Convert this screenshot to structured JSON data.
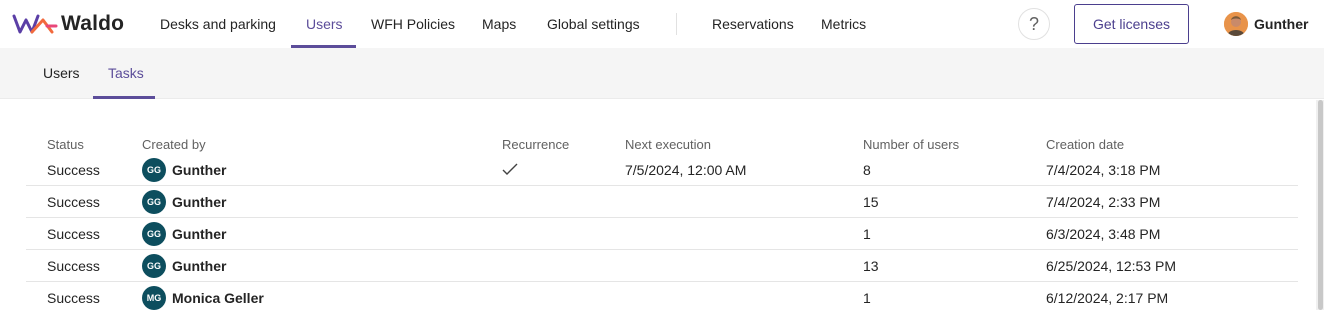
{
  "app": {
    "brand": "Waldo"
  },
  "nav": {
    "items": [
      {
        "label": "Desks and parking"
      },
      {
        "label": "Users"
      },
      {
        "label": "WFH Policies"
      },
      {
        "label": "Maps"
      },
      {
        "label": "Global settings"
      },
      {
        "label": "Reservations"
      },
      {
        "label": "Metrics"
      }
    ],
    "active": "Users",
    "help_label": "?",
    "license_label": "Get licenses",
    "user_name": "Gunther"
  },
  "subnav": {
    "tabs": [
      {
        "label": "Users"
      },
      {
        "label": "Tasks"
      }
    ],
    "active": "Tasks"
  },
  "table": {
    "columns": [
      "Status",
      "Created by",
      "Recurrence",
      "Next execution",
      "Number of users",
      "Creation date"
    ],
    "rows": [
      {
        "status": "Success",
        "initials": "GG",
        "creator": "Gunther",
        "recurrence": "✓",
        "next_execution": "7/5/2024, 12:00 AM",
        "users": "8",
        "created": "7/4/2024, 3:18 PM"
      },
      {
        "status": "Success",
        "initials": "GG",
        "creator": "Gunther",
        "recurrence": "",
        "next_execution": "",
        "users": "15",
        "created": "7/4/2024, 2:33 PM"
      },
      {
        "status": "Success",
        "initials": "GG",
        "creator": "Gunther",
        "recurrence": "",
        "next_execution": "",
        "users": "1",
        "created": "6/3/2024, 3:48 PM"
      },
      {
        "status": "Success",
        "initials": "GG",
        "creator": "Gunther",
        "recurrence": "",
        "next_execution": "",
        "users": "13",
        "created": "6/25/2024, 12:53 PM"
      },
      {
        "status": "Success",
        "initials": "MG",
        "creator": "Monica Geller",
        "recurrence": "",
        "next_execution": "",
        "users": "1",
        "created": "6/12/2024, 2:17 PM"
      }
    ]
  },
  "colors": {
    "accent": "#5c4d9a",
    "avatar_bg": "#0d4e5e",
    "button_border": "#4b3f8e"
  }
}
